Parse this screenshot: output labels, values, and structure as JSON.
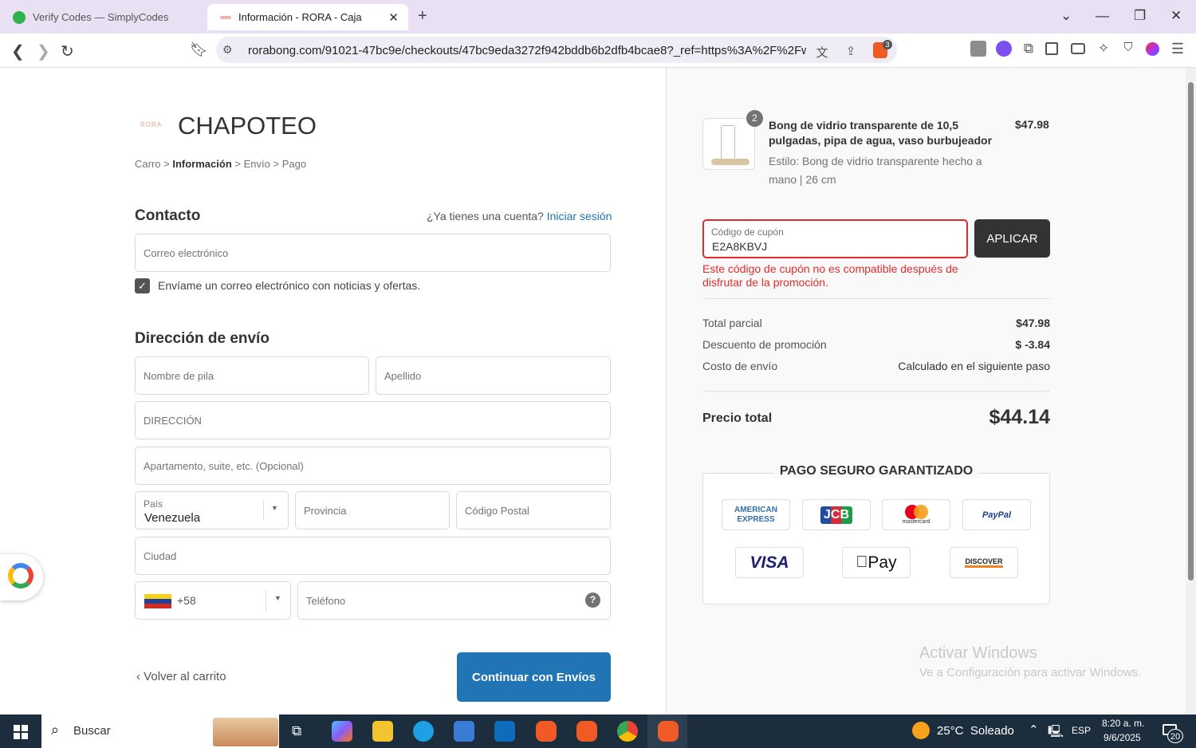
{
  "browser": {
    "tabs": [
      {
        "title": "Verify Codes — SimplyCodes",
        "active": false
      },
      {
        "title": "Información - RORA - Caja",
        "active": true
      }
    ],
    "url": "rorabong.com/91021-47bc9e/checkouts/47bc9eda3272f942bddb6b2dfb4bcae8?_ref=https%3A%2F%2Fw...",
    "shield_count": "3"
  },
  "store": {
    "logo_text": "RORA",
    "name": "CHAPOTEO"
  },
  "breadcrumb": {
    "cart": "Carro",
    "sep": ">",
    "info": "Información",
    "shipping": "Envío",
    "payment": "Pago"
  },
  "contact": {
    "heading": "Contacto",
    "account_prompt": "¿Ya tienes una cuenta?",
    "login_link": "Iniciar sesión",
    "email_placeholder": "Correo electrónico",
    "newsletter_label": "Envíame un correo electrónico con noticias y ofertas.",
    "newsletter_checked": true
  },
  "shipping": {
    "heading": "Dirección de envío",
    "first_name": "Nombre de pila",
    "last_name": "Apellido",
    "address": "DIRECCIÓN",
    "apartment": "Apartamento, suite, etc. (Opcional)",
    "country_label": "País",
    "country_value": "Venezuela",
    "province": "Provincia",
    "postal": "Código Postal",
    "city": "Ciudad",
    "phone_code": "+58",
    "phone": "Teléfono"
  },
  "actions": {
    "back": "Volver al carrito",
    "continue": "Continuar con Envíos"
  },
  "order": {
    "qty": "2",
    "product_title": "Bong de vidrio transparente de 10,5 pulgadas, pipa de agua, vaso burbujeador",
    "variant": "Estilo: Bong de vidrio transparente hecho a mano | 26 cm",
    "price": "$47.98",
    "coupon_label": "Código de cupón",
    "coupon_value": "E2A8KBVJ",
    "apply": "APLICAR",
    "coupon_error": "Este código de cupón no es compatible después de disfrutar de la promoción.",
    "subtotal_label": "Total parcial",
    "subtotal": "$47.98",
    "discount_label": "Descuento de promoción",
    "discount": "$ -3.84",
    "shipping_label": "Costo de envío",
    "shipping_value": "Calculado en el siguiente paso",
    "total_label": "Precio total",
    "total": "$44.14",
    "secure_title": "PAGO SEGURO GARANTIZADO",
    "payment_methods": [
      "AMERICAN EXPRESS",
      "JCB",
      "mastercard",
      "PayPal",
      "VISA",
      "Pay",
      "DISCOVER"
    ]
  },
  "watermark": {
    "title": "Activar Windows",
    "subtitle": "Ve a Configuración para activar Windows."
  },
  "taskbar": {
    "search": "Buscar",
    "weather": "25°C  Soleado",
    "lang": "ESP",
    "time": "8:20 a. m.",
    "date": "9/6/2025",
    "notif": "20"
  },
  "colors": {
    "accent": "#2275b5",
    "error": "#e32c2b",
    "apply_bg": "#333333"
  }
}
